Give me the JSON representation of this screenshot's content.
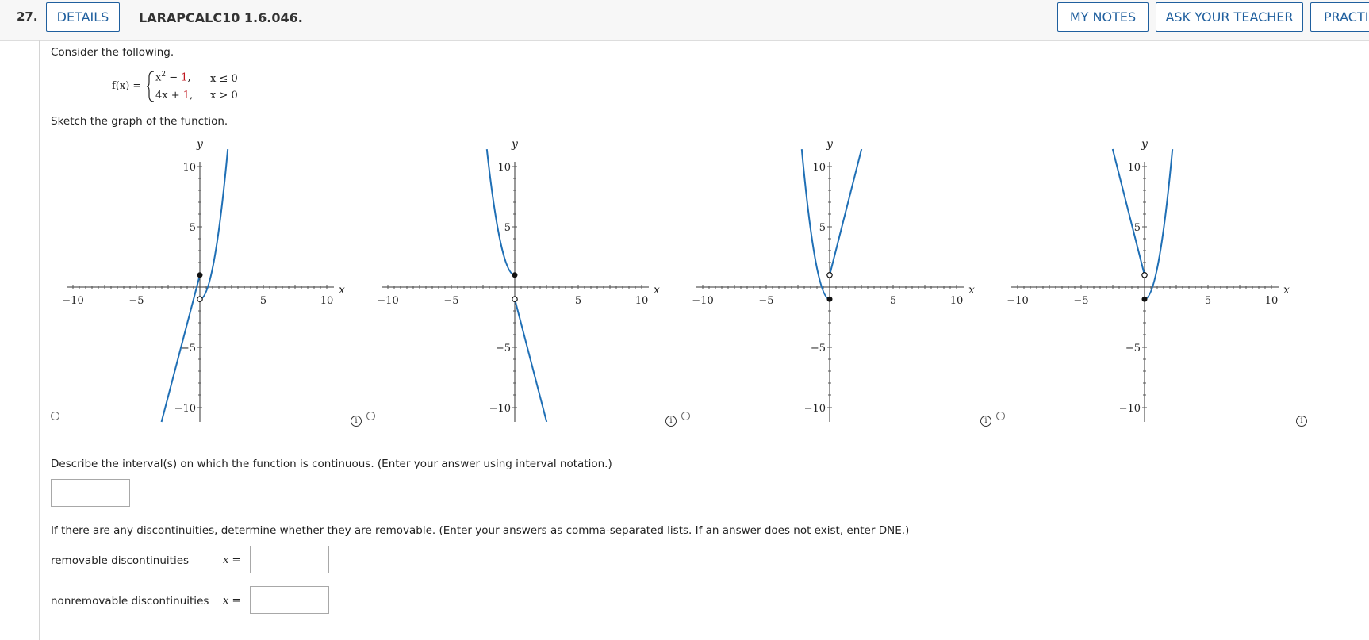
{
  "header": {
    "question_number": "27.",
    "details_label": "DETAILS",
    "question_code": "LARAPCALC10 1.6.046.",
    "my_notes_label": "MY NOTES",
    "ask_teacher_label": "ASK YOUR TEACHER",
    "practice_label": "PRACTI"
  },
  "problem": {
    "intro": "Consider the following.",
    "function_name": "f(x) =",
    "piece1_expr_main": "x",
    "piece1_expr_sup": "2",
    "piece1_expr_minus": " − ",
    "piece1_expr_const": "1",
    "piece1_expr_comma": ",",
    "piece1_cond": "x ≤ 0",
    "piece2_expr_main": "4x + ",
    "piece2_expr_const": "1",
    "piece2_expr_comma": ",",
    "piece2_cond": "x > 0",
    "sketch_prompt": "Sketch the graph of the function."
  },
  "graph_axes": {
    "x_label": "x",
    "y_label": "y",
    "x_ticks": [
      "−10",
      "−5",
      "5",
      "10"
    ],
    "y_ticks": [
      "10",
      "5",
      "−5",
      "−10"
    ]
  },
  "graph_options": [
    {
      "description": "y = 4x + 1 for x ≤ 0 and y = x² − 1 for x > 0; filled dot at (0, 1), open dot at (0, −1)"
    },
    {
      "description": "y = x² + 1 for x ≤ 0 and y = −4x − 1 for x > 0; filled dot at (0, 1), open dot at (0, −1)"
    },
    {
      "description": "y = x² − 1 for x ≤ 0 and y = 4x + 1 for x > 0; filled dot at (0, −1), open dot at (0, 1)"
    },
    {
      "description": "y = −4x + 1 for x ≤ 0 and y = x² − 1 for x > 0; filled dot at (0, −1), open dot at (0, 1)"
    }
  ],
  "info_icon_glyph": "i",
  "continuity": {
    "prompt": "Describe the interval(s) on which the function is continuous. (Enter your answer using interval notation.)",
    "answer_value": ""
  },
  "discontinuities": {
    "prompt": "If there are any discontinuities, determine whether they are removable. (Enter your answers as comma-separated lists. If an answer does not exist, enter DNE.)",
    "removable_label": "removable discontinuities",
    "nonremovable_label": "nonremovable discontinuities",
    "x_equals": "x =",
    "removable_value": "",
    "nonremovable_value": ""
  },
  "colors": {
    "accent": "#1f5f9e",
    "curve": "#1f6fb5",
    "red_constants": "#c0171f"
  }
}
